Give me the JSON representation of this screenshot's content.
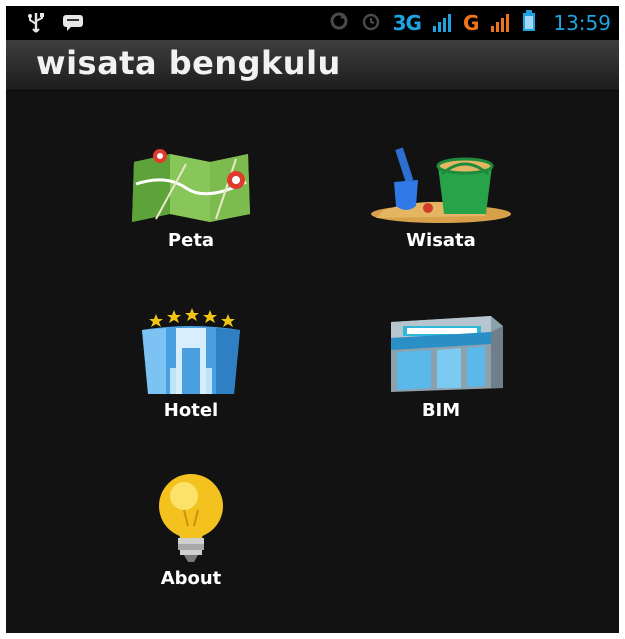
{
  "status_bar": {
    "network_3g": "3G",
    "network_g": "G",
    "time": "13:59",
    "icons": [
      "usb-icon",
      "message-icon",
      "sync-icon",
      "alarm-icon",
      "signal-icon",
      "battery-icon"
    ]
  },
  "app": {
    "title": "wisata bengkulu"
  },
  "menu": {
    "items": [
      {
        "label": "Peta",
        "icon": "map-icon"
      },
      {
        "label": "Wisata",
        "icon": "beach-bucket-icon"
      },
      {
        "label": "Hotel",
        "icon": "hotel-icon"
      },
      {
        "label": "BIM",
        "icon": "shop-icon"
      },
      {
        "label": "About",
        "icon": "lightbulb-icon"
      }
    ]
  }
}
